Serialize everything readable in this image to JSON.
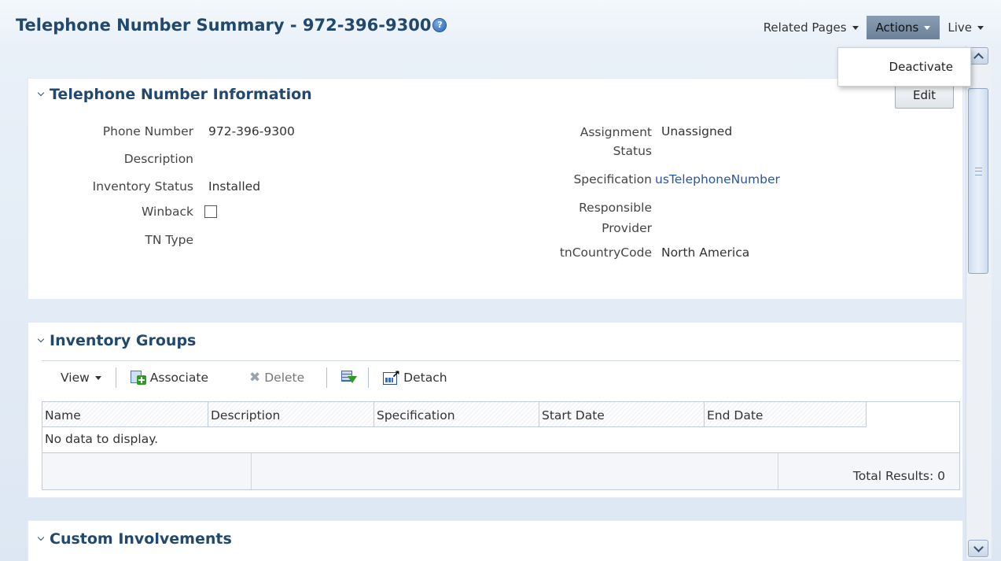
{
  "header": {
    "title": "Telephone Number Summary - 972-396-9300",
    "help_icon": "help-question-icon",
    "nav": {
      "related_pages": "Related Pages",
      "actions": "Actions",
      "live": "Live"
    },
    "actions_menu": [
      "Deactivate"
    ]
  },
  "info_panel": {
    "title": "Telephone Number Information",
    "edit_label": "Edit",
    "left_fields": [
      {
        "label": "Phone Number",
        "value": "972-396-9300"
      },
      {
        "label": "Description",
        "value": ""
      },
      {
        "label": "Inventory Status",
        "value": "Installed"
      },
      {
        "label": "Winback",
        "value": "",
        "checkbox_checked": false
      },
      {
        "label": "TN Type",
        "value": ""
      }
    ],
    "right_fields": [
      {
        "label_line1": "Assignment",
        "label_line2": "Status",
        "value": "Unassigned"
      },
      {
        "label": "Specification",
        "value": "usTelephoneNumber"
      },
      {
        "label_line1": "Responsible",
        "label_line2": "Provider",
        "value": ""
      },
      {
        "label": "tnCountryCode",
        "value": "North America"
      }
    ]
  },
  "groups_panel": {
    "title": "Inventory Groups",
    "toolbar": {
      "view": "View",
      "associate": "Associate",
      "delete": "Delete",
      "detach": "Detach"
    },
    "columns": [
      "Name",
      "Description",
      "Specification",
      "Start Date",
      "End Date"
    ],
    "empty_message": "No data to display.",
    "total_results": "Total Results: 0"
  },
  "custom_panel": {
    "title": "Custom Involvements"
  },
  "colors": {
    "title_blue": "#22486e",
    "link_blue": "#2b55a0",
    "active_nav": "#6c8199"
  }
}
